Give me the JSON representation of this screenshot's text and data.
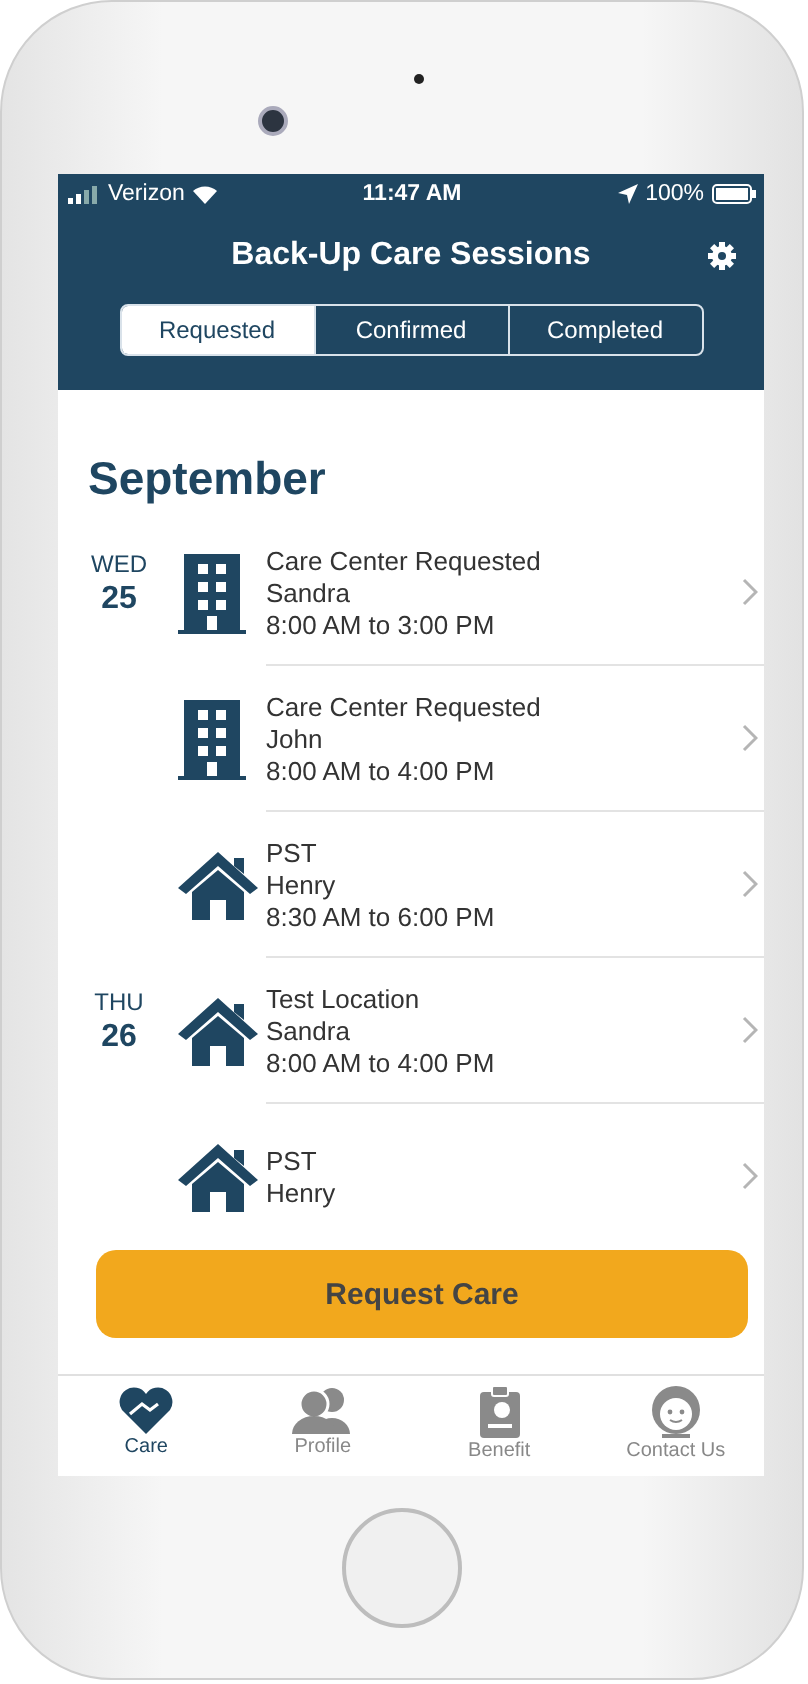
{
  "status_bar": {
    "carrier": "Verizon",
    "time": "11:47 AM",
    "battery": "100%"
  },
  "header": {
    "title": "Back-Up Care Sessions"
  },
  "tabs": [
    {
      "label": "Requested",
      "selected": true
    },
    {
      "label": "Confirmed",
      "selected": false
    },
    {
      "label": "Completed",
      "selected": false
    }
  ],
  "month": "September",
  "sessions": [
    {
      "weekday": "WED",
      "day": "25",
      "kind": "center",
      "title": "Care Center Requested",
      "name": "Sandra",
      "time": "8:00 AM to 3:00 PM"
    },
    {
      "kind": "center",
      "title": "Care Center Requested",
      "name": "John",
      "time": "8:00 AM to 4:00 PM"
    },
    {
      "kind": "home",
      "title": "PST",
      "name": "Henry",
      "time": "8:30 AM to 6:00 PM"
    },
    {
      "weekday": "THU",
      "day": "26",
      "kind": "home",
      "title": "Test Location",
      "name": "Sandra",
      "time": "8:00 AM to 4:00 PM"
    },
    {
      "kind": "home",
      "title": "PST",
      "name": "Henry"
    }
  ],
  "primary_button": "Request Care",
  "nav": [
    {
      "label": "Care",
      "selected": true
    },
    {
      "label": "Profile",
      "selected": false
    },
    {
      "label": "Benefit",
      "selected": false
    },
    {
      "label": "Contact Us",
      "selected": false
    }
  ]
}
